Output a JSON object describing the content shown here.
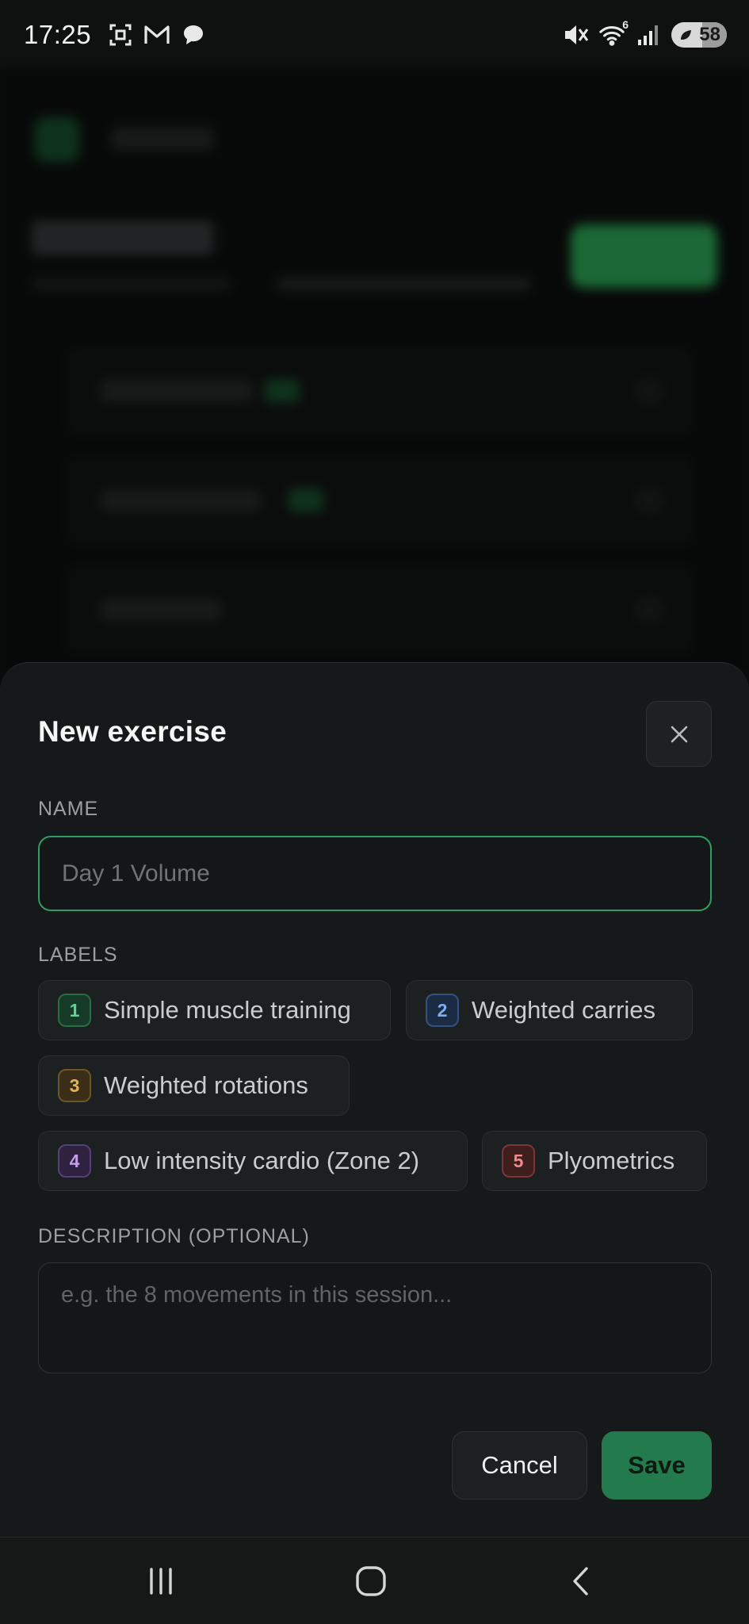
{
  "status_bar": {
    "time": "17:25",
    "left_icons": [
      "screenshot-icon",
      "gmail-icon",
      "chat-bubble-icon"
    ],
    "right_icons": [
      "mute-icon",
      "wifi-icon",
      "signal-icon"
    ],
    "wifi_badge": "6",
    "battery_level": "58"
  },
  "sheet": {
    "title": "New exercise",
    "name_label": "NAME",
    "name_value": "",
    "name_placeholder": "Day 1 Volume",
    "labels_label": "LABELS",
    "labels": [
      {
        "num": "1",
        "text": "Simple muscle training",
        "color": "#5fd492"
      },
      {
        "num": "2",
        "text": "Weighted carries",
        "color": "#7eaef0"
      },
      {
        "num": "3",
        "text": "Weighted rotations",
        "color": "#e0b25a"
      },
      {
        "num": "4",
        "text": "Low intensity cardio (Zone 2)",
        "color": "#c59cf0"
      },
      {
        "num": "5",
        "text": "Plyometrics",
        "color": "#ef8a8a"
      }
    ],
    "description_label": "DESCRIPTION (OPTIONAL)",
    "description_placeholder": "e.g. the 8 movements in this session...",
    "cancel_label": "Cancel",
    "save_label": "Save"
  },
  "colors": {
    "accent": "#237a4c",
    "focus_border": "#2f9e63",
    "sheet_background": "#161919"
  },
  "nav_bar": {
    "buttons": [
      "recent-apps-icon",
      "home-icon",
      "back-icon"
    ]
  }
}
